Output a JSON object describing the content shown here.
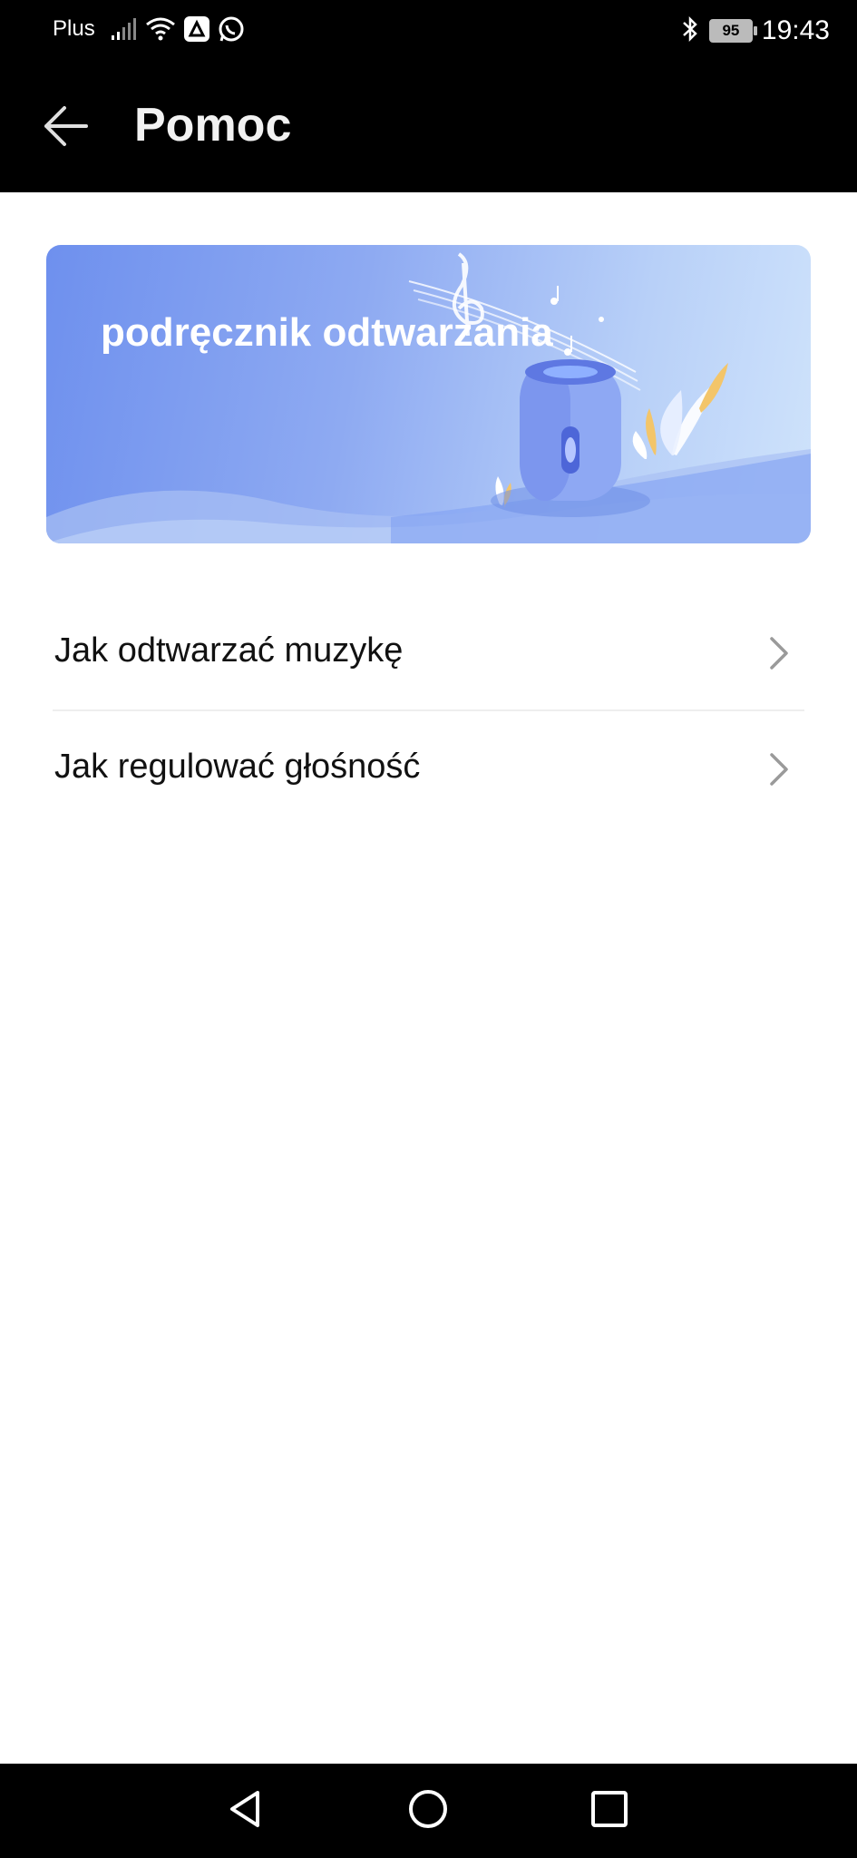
{
  "status_bar": {
    "carrier": "Plus",
    "battery": "95",
    "time": "19:43",
    "icons_left": [
      "signal-icon",
      "wifi-icon",
      "notification-app-icon",
      "whatsapp-icon"
    ],
    "icons_right": [
      "bluetooth-icon",
      "battery-icon"
    ]
  },
  "app_bar": {
    "title": "Pomoc",
    "back_icon": "arrow-left-icon"
  },
  "banner": {
    "title": "podręcznik odtwarzania",
    "colors": {
      "start": "#6e90ee",
      "end": "#cfe3fb"
    }
  },
  "help_items": [
    {
      "label": "Jak odtwarzać muzykę"
    },
    {
      "label": "Jak regulować głośność"
    }
  ],
  "nav_bar": {
    "buttons": [
      "back-triangle-icon",
      "home-circle-icon",
      "recents-square-icon"
    ]
  }
}
